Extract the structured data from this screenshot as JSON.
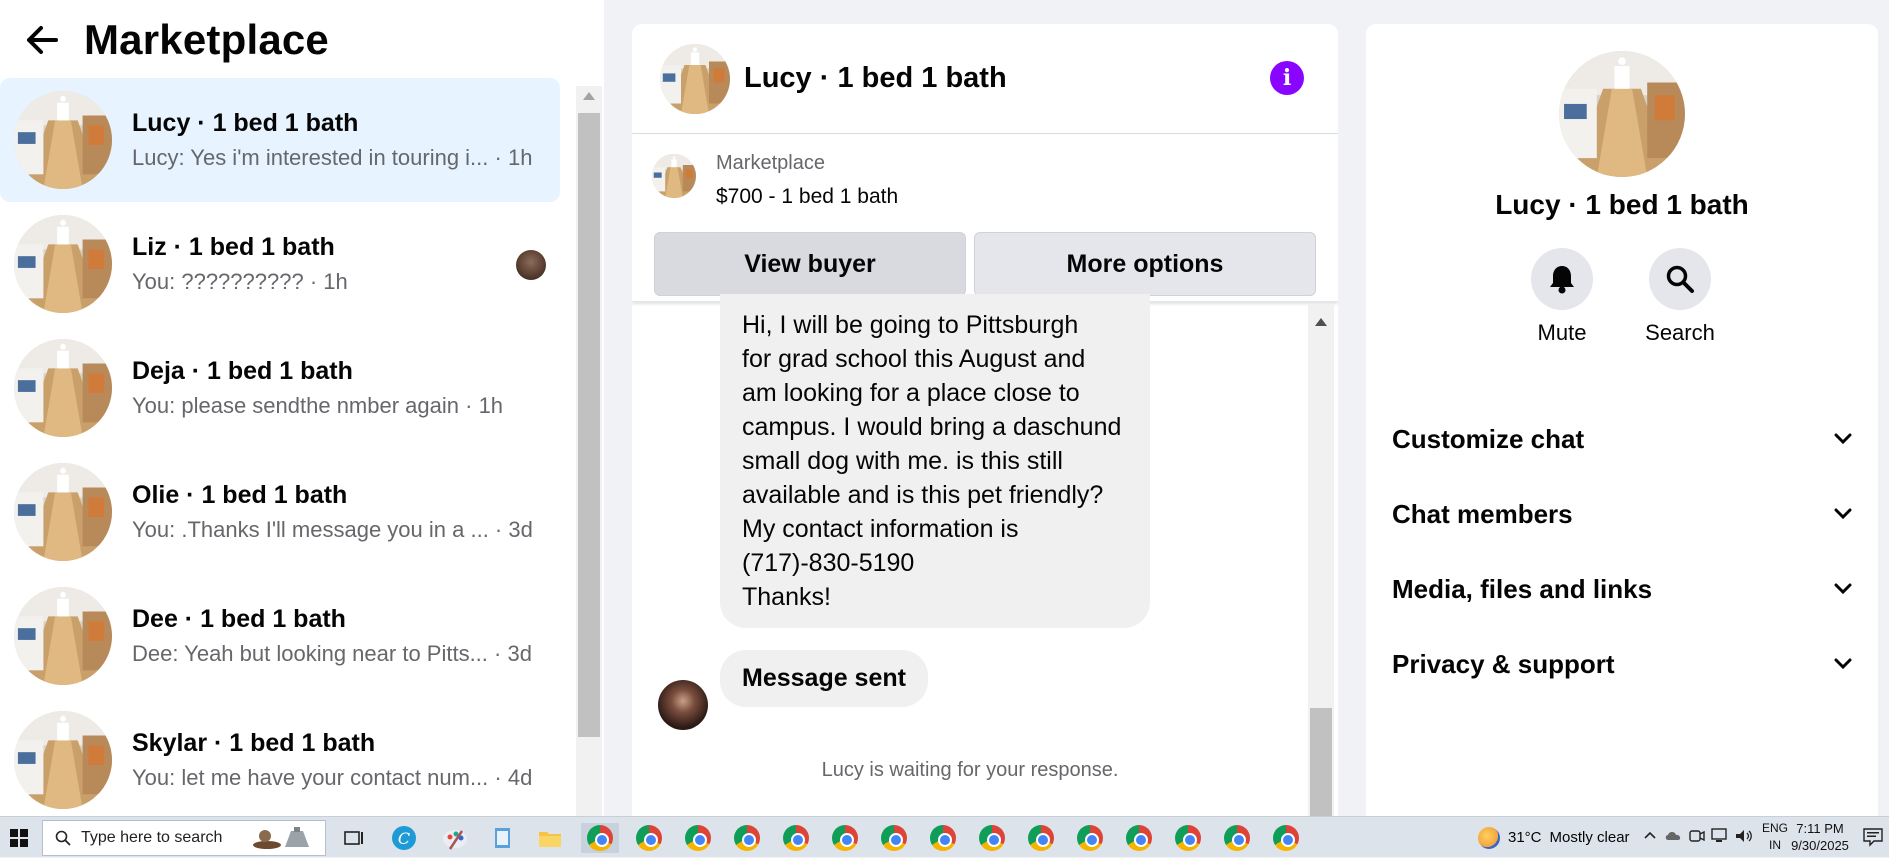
{
  "colors": {
    "accent": "#8a05ff",
    "active_row": "#e7f3ff",
    "muted_text": "#65676b"
  },
  "left": {
    "title": "Marketplace",
    "conversations": [
      {
        "name": "Lucy · 1 bed 1 bath",
        "snippet": "Lucy: Yes i'm interested in touring i...",
        "time": "1h",
        "active": true
      },
      {
        "name": "Liz · 1 bed 1 bath",
        "snippet": "You: ??????????",
        "time": "1h",
        "active": false
      },
      {
        "name": "Deja · 1 bed 1 bath",
        "snippet": "You: please sendthe nmber again",
        "time": "1h",
        "active": false
      },
      {
        "name": "Olie · 1 bed 1 bath",
        "snippet": "You: .Thanks I'll message you in a ... ",
        "time": "3d",
        "active": false
      },
      {
        "name": "Dee · 1 bed 1 bath",
        "snippet": "Dee: Yeah but looking near to Pitts...",
        "time": "3d",
        "active": false
      },
      {
        "name": "Skylar · 1 bed 1 bath",
        "snippet": "You: let me have your contact num...",
        "time": "4d",
        "active": false
      }
    ]
  },
  "chat": {
    "title": "Lucy · 1 bed 1 bath",
    "listing": {
      "source": "Marketplace",
      "price_title": "$700 - 1 bed 1 bath"
    },
    "view_buyer": "View buyer",
    "more_options": "More options",
    "message_lines": [
      "Hi, I will be going to Pittsburgh",
      "for grad school this August and",
      "am looking for a place close to",
      "campus. I would bring a daschund",
      "small dog with me. is this still",
      "available and is this pet friendly?",
      "My contact information is",
      "(717)-830-5190",
      "Thanks!"
    ],
    "sent_message": "Message sent",
    "waiting": "Lucy is waiting for your response."
  },
  "details": {
    "name": "Lucy · 1 bed 1 bath",
    "mute": "Mute",
    "search": "Search",
    "menu": [
      "Customize chat",
      "Chat members",
      "Media, files and links",
      "Privacy & support"
    ]
  },
  "taskbar": {
    "search_placeholder": "Type here to search",
    "temperature": "31°C",
    "weather": "Mostly clear",
    "lang_top": "ENG",
    "lang_bottom": "IN",
    "time": "7:11 PM",
    "date": "9/30/2025"
  }
}
